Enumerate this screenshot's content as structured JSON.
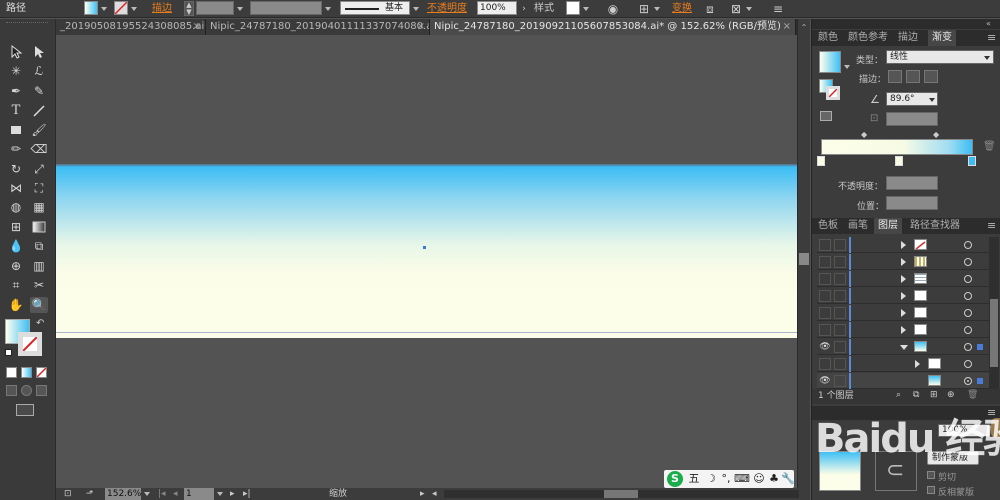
{
  "control_bar": {
    "path_label": "路径",
    "stroke_label": "描边",
    "stroke_profile": "基本",
    "opacity_label": "不透明度",
    "opacity_value": "100%",
    "style_label": "样式",
    "transform_label": "变换"
  },
  "tabs": [
    {
      "label": "_20190508195524308085.ai*"
    },
    {
      "label": "Nipic_24787180_20190401111337074080.ai*"
    },
    {
      "label": "Nipic_24787180_20190921105607853084.ai* @ 152.62% (RGB/预览)"
    }
  ],
  "status_bar": {
    "zoom": "152.6%",
    "page": "1",
    "mode": "缩放"
  },
  "gradient_panel": {
    "tabs": [
      "颜色",
      "颜色参考",
      "描边",
      "渐变"
    ],
    "active_tab": "渐变",
    "type_label": "类型：",
    "type_value": "线性",
    "stroke_label": "描边：",
    "angle_value": "89.6°",
    "opacity_label": "不透明度：",
    "location_label": "位置："
  },
  "layers_panel": {
    "tabs": [
      "色板",
      "画笔",
      "图层",
      "路径查找器"
    ],
    "active_tab": "图层",
    "footer_label": "1 个图层"
  },
  "bottom_panel": {
    "opacity_value": "100%",
    "make_mask_label": "制作蒙版",
    "clip_label": "剪切",
    "invert_mask_label": "反相蒙版"
  },
  "watermark": "Baidu 经验",
  "ime": {
    "char": "五"
  },
  "colors": {
    "gradient_start": "#fdfee9",
    "gradient_end": "#3cbdf4",
    "accent_orange": "#e87d1e"
  }
}
